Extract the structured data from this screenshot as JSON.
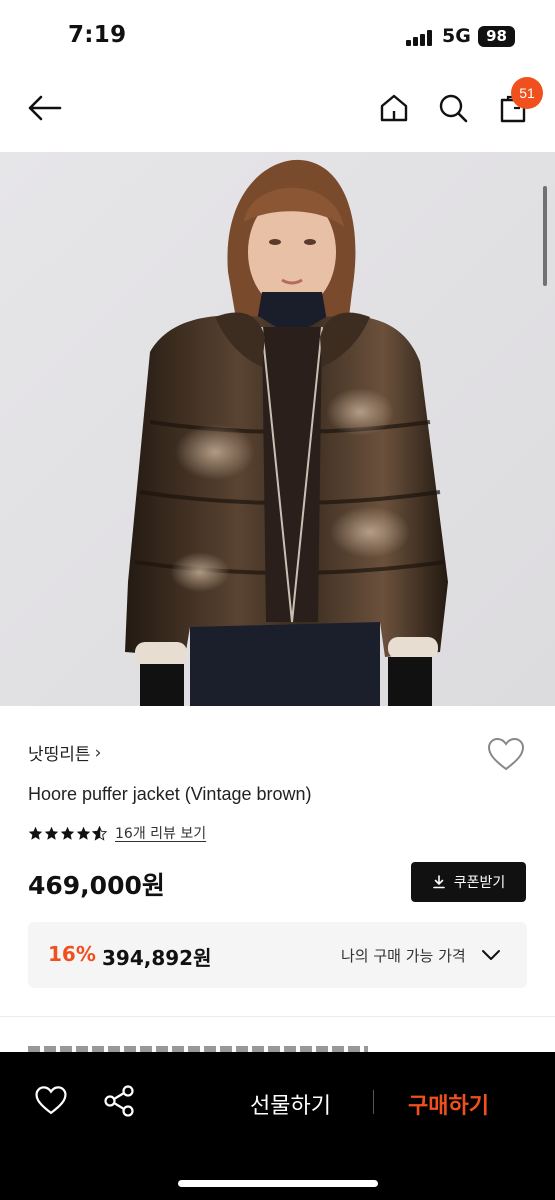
{
  "status_bar": {
    "time": "7:19",
    "network": "5G",
    "battery": "98"
  },
  "nav": {
    "back_icon": "arrow-left-icon",
    "home_icon": "home-icon",
    "search_icon": "search-icon",
    "cart_icon": "cart-icon",
    "cart_count": "51"
  },
  "product": {
    "brand": "낫띵리튼",
    "brand_chevron": "›",
    "title": "Hoore puffer jacket (Vintage brown)",
    "rating": 4.5,
    "review_link": "16개 리뷰 보기",
    "price": "469,000원",
    "coupon_label": "쿠폰받기",
    "discount_rate": "16%",
    "discount_price": "394,892원",
    "my_price_label": "나의 구매 가능 가격"
  },
  "bottom_bar": {
    "gift_label": "선물하기",
    "buy_label": "구매하기"
  },
  "colors": {
    "accent": "#f0501e",
    "dark": "#111111"
  }
}
